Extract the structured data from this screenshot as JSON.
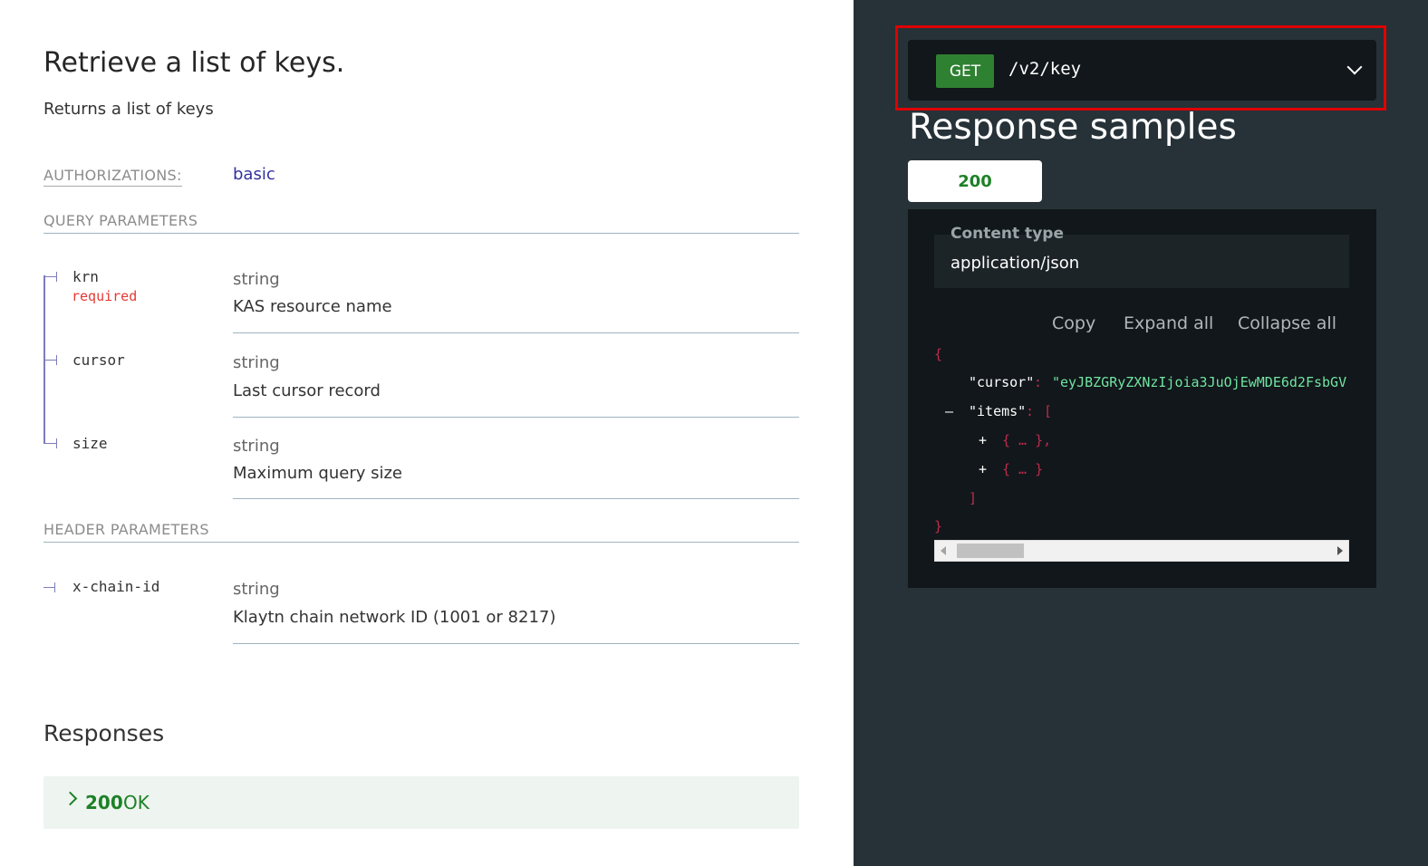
{
  "operation": {
    "title": "Retrieve a list of keys.",
    "description": "Returns a list of keys"
  },
  "authorizations": {
    "label": "AUTHORIZATIONS:",
    "value": "basic"
  },
  "query_params": {
    "title": "QUERY PARAMETERS",
    "items": [
      {
        "name": "krn",
        "required": "required",
        "type": "string",
        "description": "KAS resource name"
      },
      {
        "name": "cursor",
        "type": "string",
        "description": "Last cursor record"
      },
      {
        "name": "size",
        "type": "string",
        "description": "Maximum query size"
      }
    ]
  },
  "header_params": {
    "title": "HEADER PARAMETERS",
    "items": [
      {
        "name": "x-chain-id",
        "type": "string",
        "description": "Klaytn chain network ID (1001 or 8217)"
      }
    ]
  },
  "responses": {
    "title": "Responses",
    "items": [
      {
        "code": "200",
        "text": "OK"
      }
    ]
  },
  "endpoint": {
    "method": "GET",
    "path": "/v2/key"
  },
  "samples": {
    "title": "Response samples",
    "tabs": [
      "200"
    ],
    "content_type_label": "Content type",
    "content_type_value": "application/json",
    "controls": {
      "copy": "Copy",
      "expand": "Expand all",
      "collapse": "Collapse all"
    },
    "json": {
      "open_brace": "{",
      "cursor_key": "\"cursor\"",
      "colon": ": ",
      "cursor_value": "\"eyJBZGRyZXNzIjoia3JuOjEwMDE6d2FsbGV",
      "collapse_toggle": "–",
      "items_key": "\"items\"",
      "items_open": "[",
      "expand_toggle": "+",
      "item1": "{ … },",
      "item2": "{ … }",
      "items_close": "]",
      "close_brace": "}"
    }
  },
  "colors": {
    "accent_link": "#32329f",
    "required": "#e53935",
    "success": "#1d8127",
    "dark_panel": "#263238",
    "code_bg": "#11171a",
    "json_string": "#71e4a2",
    "json_punctuation": "#bd2c4f",
    "highlight_box": "#e00000"
  },
  "icons": {
    "response_expand": "chevron-right-icon",
    "endpoint_toggle": "chevron-down-icon",
    "param_tree": "tree-branch-icon"
  }
}
